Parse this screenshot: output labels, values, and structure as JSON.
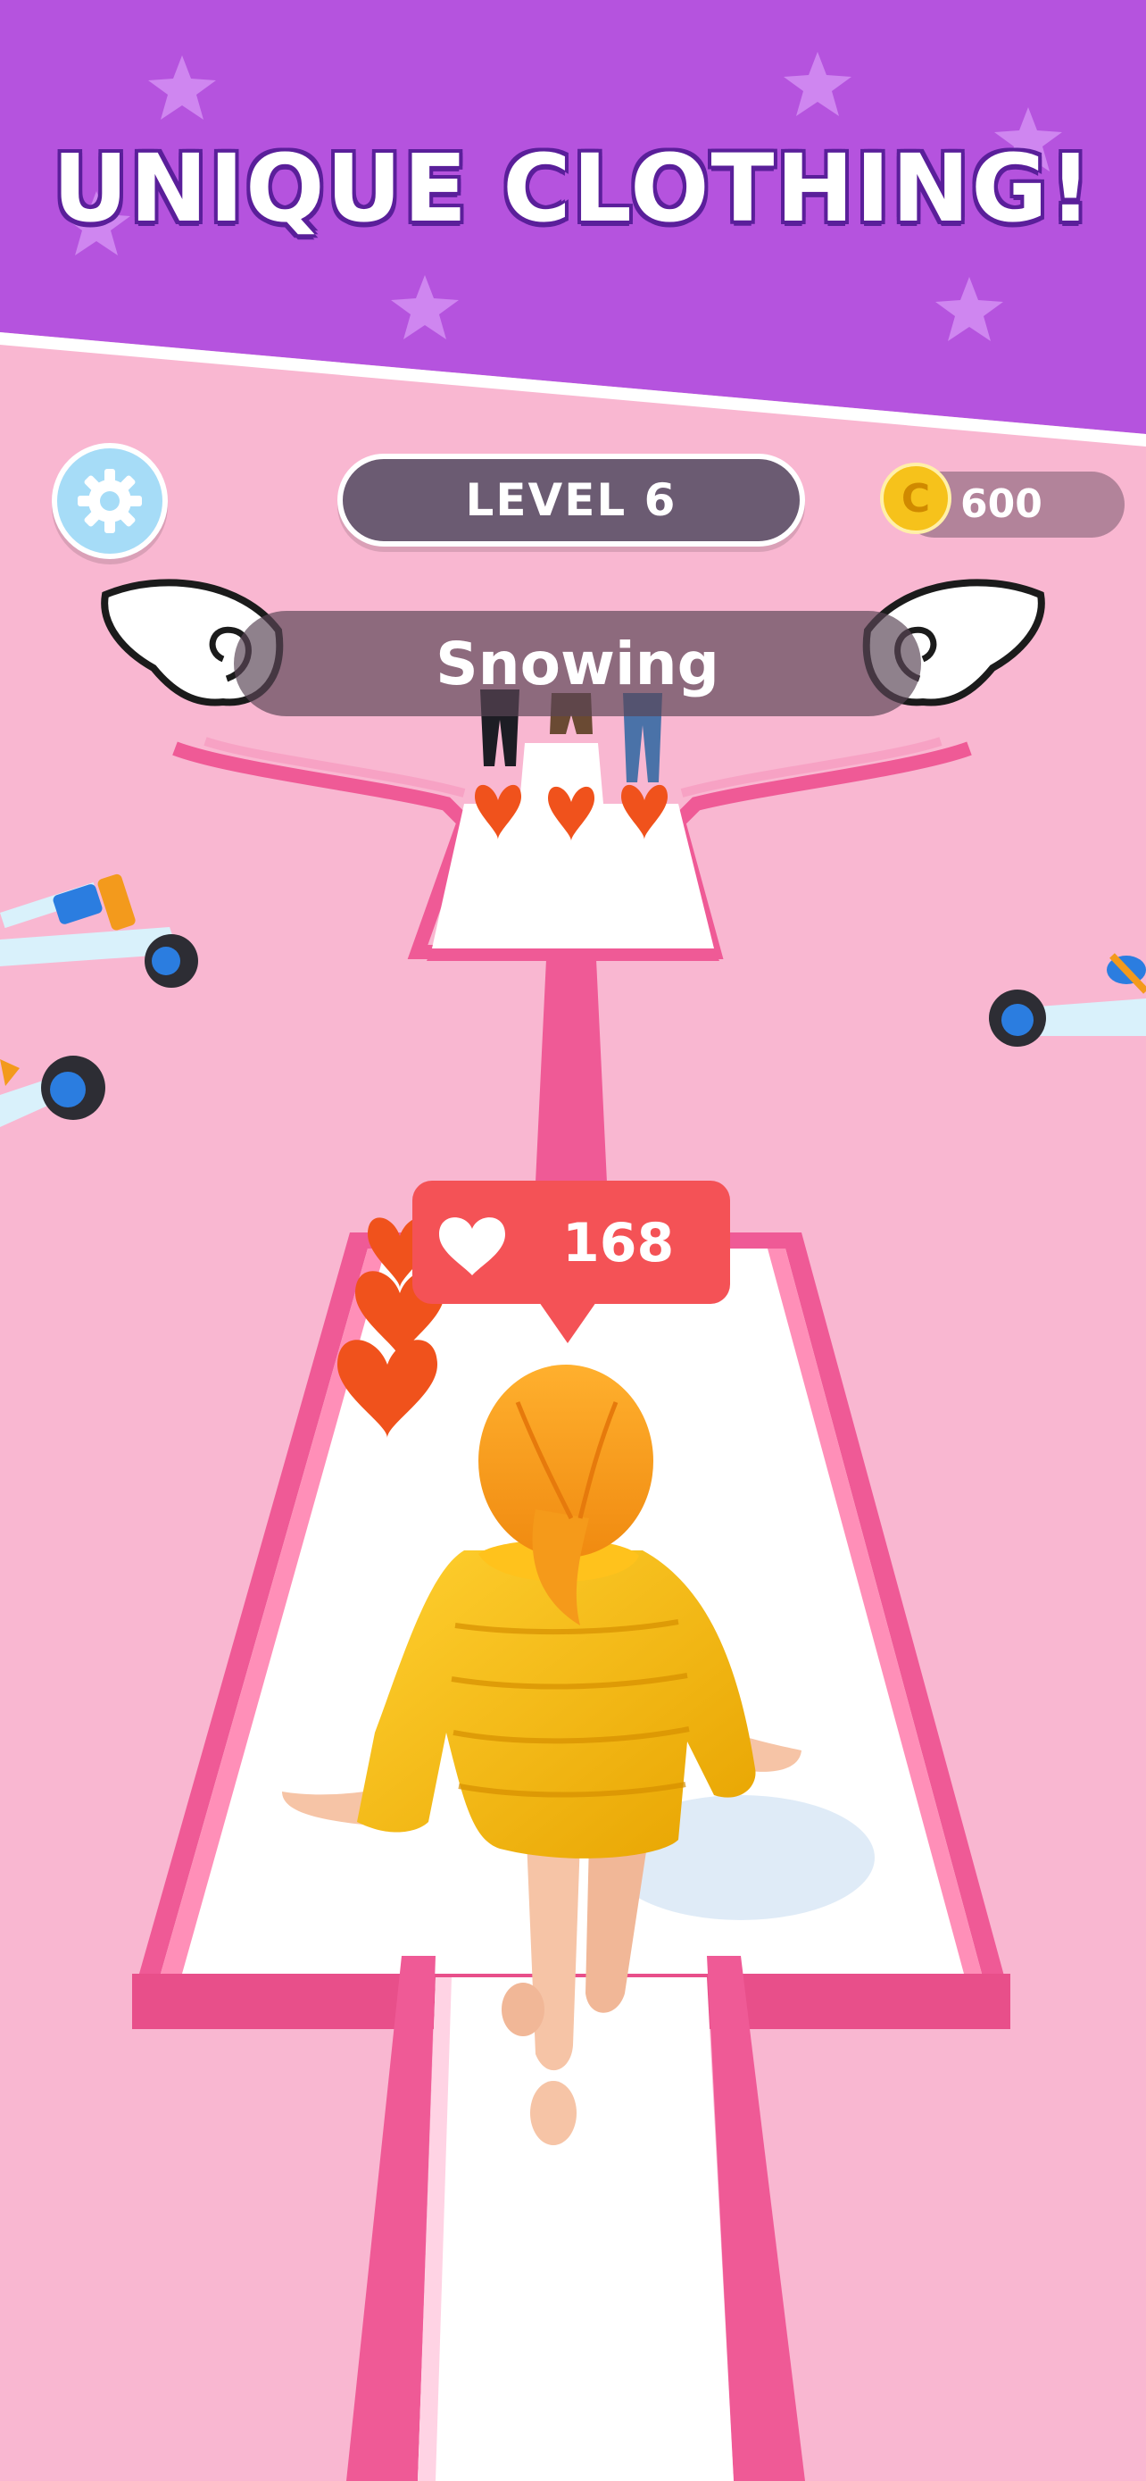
{
  "banner": {
    "title": "UNIQUE CLOTHING!"
  },
  "hud": {
    "level_label": "LEVEL 6",
    "coins": "600",
    "coin_symbol": "C",
    "weather": "Snowing"
  },
  "likes": {
    "count": "168"
  },
  "icons": {
    "settings": "gear-icon",
    "coin": "coin-icon",
    "like": "heart-icon",
    "wings": "angel-wing-icon"
  },
  "colors": {
    "banner_purple": "#b553de",
    "ground_pink": "#f9b7d1",
    "track_edge": "#ef5a96",
    "like_red": "#f45256",
    "coat_yellow": "#f4b400",
    "level_pill": "#6b5b72"
  }
}
